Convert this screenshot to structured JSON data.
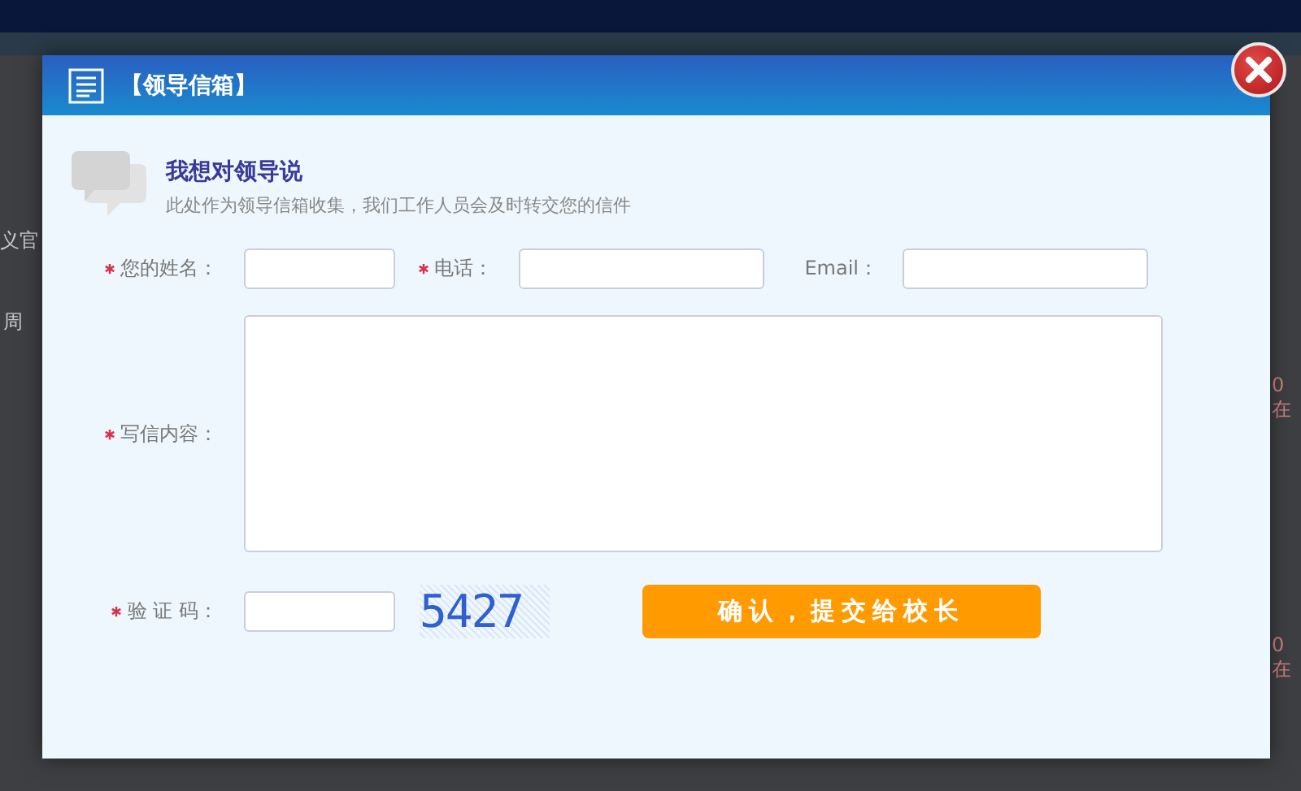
{
  "backdrop": {
    "fragments": [
      {
        "text": "义官"
      },
      {
        "text": "周"
      },
      {
        "text": "0在"
      },
      {
        "text": "0在"
      }
    ]
  },
  "dialog": {
    "title": "【领导信箱】",
    "heading": "我想对领导说",
    "subtitle": "此处作为领导信箱收集，我们工作人员会及时转交您的信件",
    "rows": [
      {
        "fields": [
          {
            "label": "您的姓名：",
            "required": true,
            "kind": "input"
          },
          {
            "label": "电话：",
            "required": true,
            "kind": "input"
          },
          {
            "label": "Email：",
            "required": false,
            "kind": "input"
          }
        ]
      },
      {
        "fields": [
          {
            "label": "写信内容：",
            "required": true,
            "kind": "textarea"
          }
        ]
      }
    ],
    "captcha": {
      "label": "验 证 码：",
      "required": true,
      "code": "5427"
    },
    "submit": "确认，提交给校长"
  }
}
